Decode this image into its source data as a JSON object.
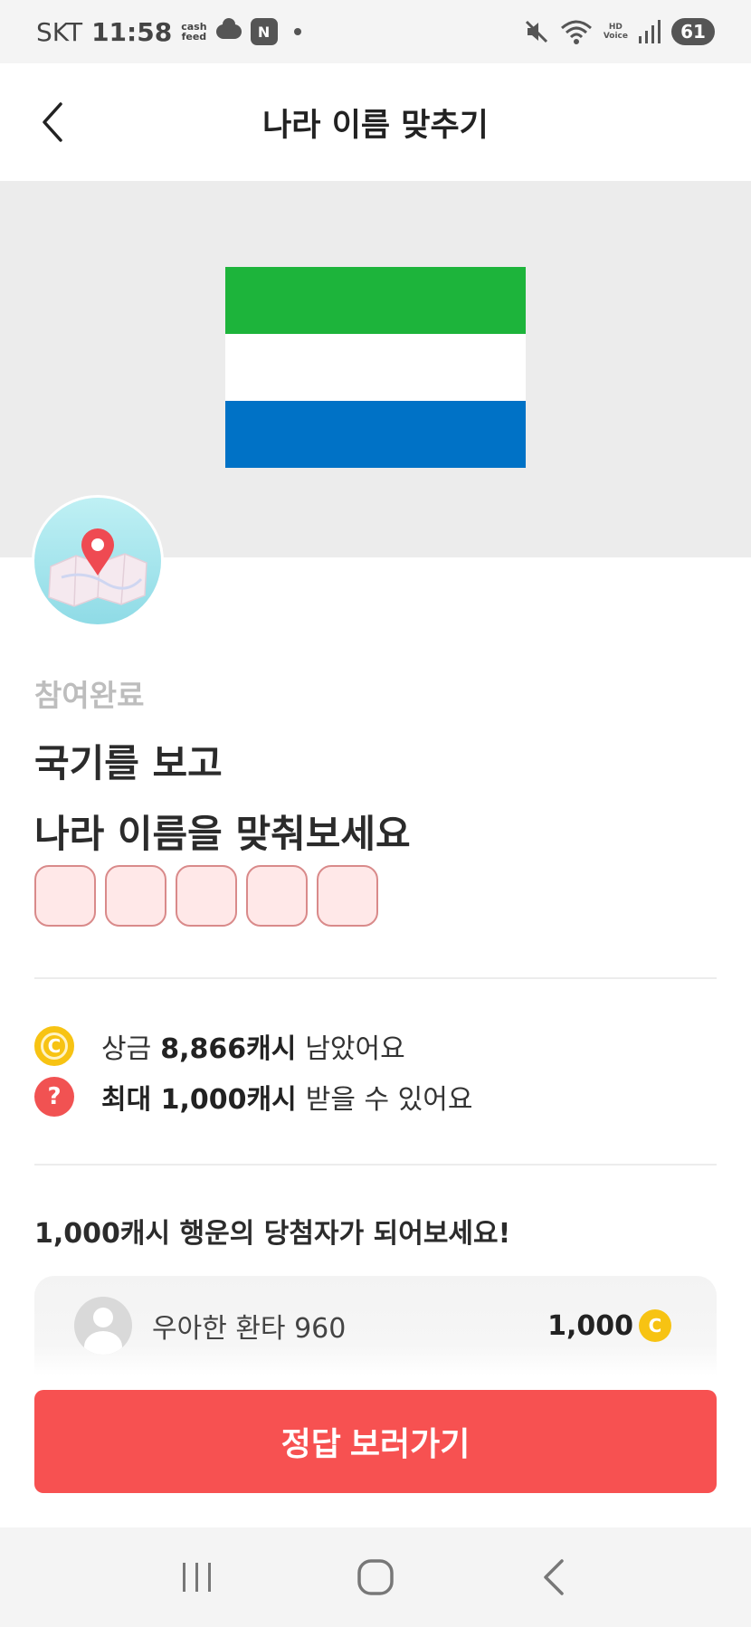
{
  "status_bar": {
    "carrier": "SKT",
    "time": "11:58",
    "cashfeed_label_1": "cash",
    "cashfeed_label_2": "feed",
    "n_badge": "N",
    "hd_label": "HD",
    "voice_label": "Voice",
    "battery": "61"
  },
  "header": {
    "title": "나라 이름 맞추기",
    "back_icon": "chevron-left-icon"
  },
  "flag": {
    "colors": [
      "#1db43b",
      "#ffffff",
      "#0072c6"
    ]
  },
  "quiz": {
    "status": "참여완료",
    "question_line1": "국기를 보고",
    "question_line2": "나라 이름을 맞춰보세요",
    "answer_box_count": 5
  },
  "info": {
    "prize_prefix": "상금",
    "prize_amount": "8,866캐시",
    "prize_suffix": "남았어요",
    "max_amount": "최대 1,000캐시",
    "max_suffix": "받을 수 있어요",
    "coin_glyph": "C",
    "question_glyph": "?"
  },
  "lucky": {
    "title": "1,000캐시 행운의 당첨자가 되어보세요!"
  },
  "winner": {
    "name": "우아한 환타 960",
    "amount": "1,000"
  },
  "cta": {
    "label": "정답 보러가기"
  },
  "colors": {
    "accent": "#f75151",
    "coin": "#f7c313"
  }
}
